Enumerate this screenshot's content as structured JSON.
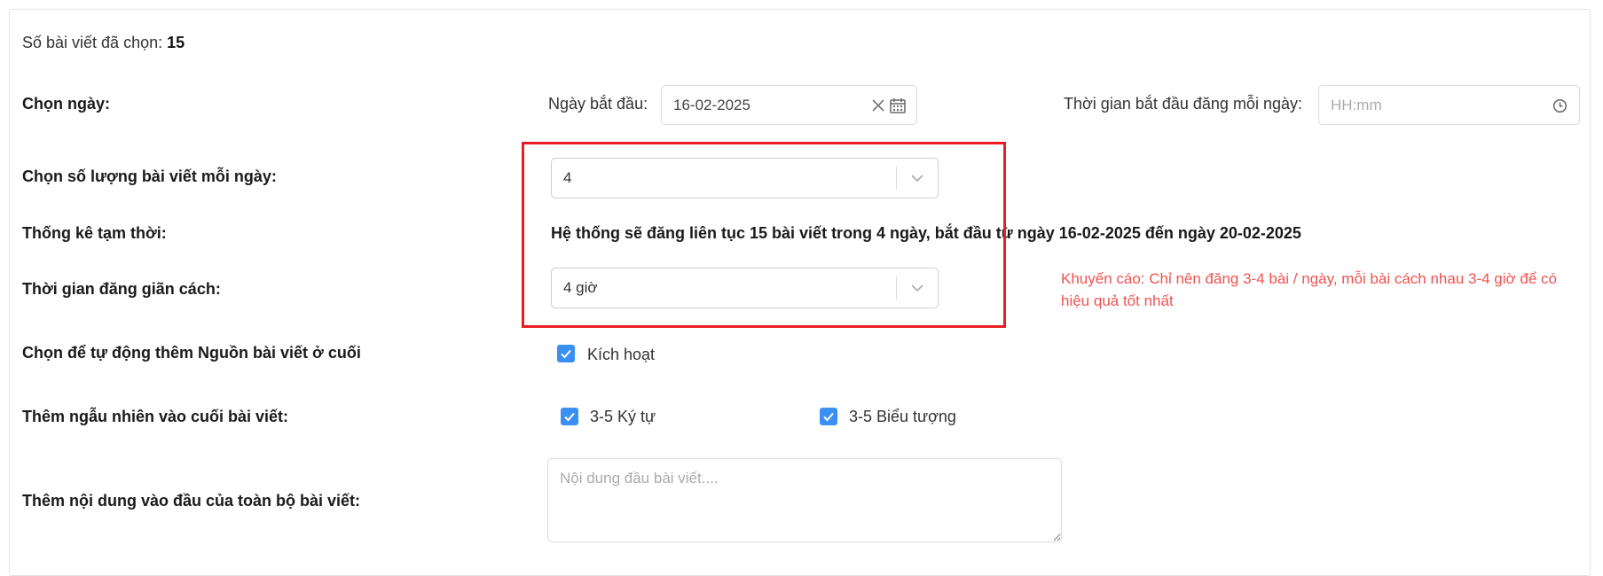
{
  "summary": {
    "label": "Số bài viết đã chọn:",
    "count": "15"
  },
  "date_row": {
    "label": "Chọn ngày:",
    "start_date_label": "Ngày bắt đầu:",
    "start_date_value": "16-02-2025",
    "start_time_label": "Thời gian bắt đầu đăng mỗi ngày:",
    "start_time_placeholder": "HH:mm"
  },
  "posts_per_day": {
    "label": "Chọn số lượng bài viết mỗi ngày:",
    "value": "4"
  },
  "stats": {
    "label": "Thống kê tạm thời:",
    "text": "Hệ thống sẽ đăng liên tục 15 bài viết trong 4 ngày, bắt đầu từ ngày 16-02-2025 đến ngày 20-02-2025"
  },
  "interval": {
    "label": "Thời gian đăng giãn cách:",
    "value": "4 giờ",
    "warning": "Khuyến cáo: Chỉ nên đăng 3-4 bài / ngày, mỗi bài cách nhau 3-4 giờ để có hiệu quả tốt nhất"
  },
  "source_append": {
    "label": "Chọn để tự động thêm Nguồn bài viết ở cuối",
    "checkbox_label": "Kích hoạt",
    "checked": true
  },
  "random_append": {
    "label": "Thêm ngẫu nhiên vào cuối bài viết:",
    "option1_label": "3-5 Ký tự",
    "option1_checked": true,
    "option2_label": "3-5 Biểu tượng",
    "option2_checked": true
  },
  "prefix_content": {
    "label": "Thêm nội dung vào đầu của toàn bộ bài viết:",
    "placeholder": "Nội dung đầu bài viết...."
  },
  "colors": {
    "accent": "#3b8ff3",
    "warning": "#ef5350",
    "highlight_box": "#ec1c24"
  },
  "icons": {
    "clear": "close-icon",
    "calendar": "calendar-icon",
    "clock": "clock-icon",
    "dropdown": "chevron-down-icon",
    "check": "check-icon"
  }
}
